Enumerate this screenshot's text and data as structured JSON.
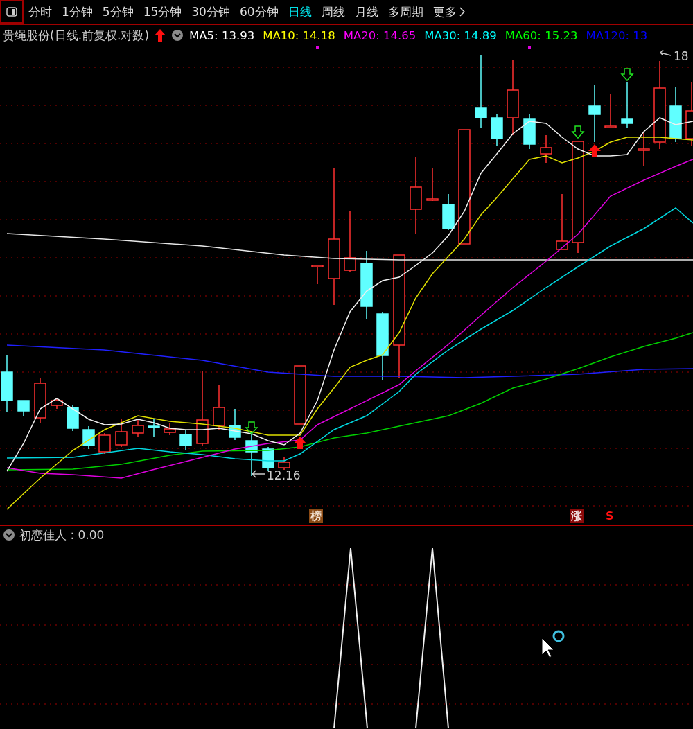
{
  "toolbar": {
    "periods": [
      {
        "label": "分时",
        "selected": false
      },
      {
        "label": "1分钟",
        "selected": false
      },
      {
        "label": "5分钟",
        "selected": false
      },
      {
        "label": "15分钟",
        "selected": false
      },
      {
        "label": "30分钟",
        "selected": false
      },
      {
        "label": "60分钟",
        "selected": false
      },
      {
        "label": "日线",
        "selected": true
      },
      {
        "label": "周线",
        "selected": false
      },
      {
        "label": "月线",
        "selected": false
      },
      {
        "label": "多周期",
        "selected": false
      }
    ],
    "more": "更多"
  },
  "legend": {
    "title": "贵绳股份(日线.前复权.对数)",
    "moving_averages": [
      {
        "label": "MA5: 13.93",
        "color": "#ffffff"
      },
      {
        "label": "MA10: 14.18",
        "color": "#ffff00"
      },
      {
        "label": "MA20: 14.65",
        "color": "#ff00ff"
      },
      {
        "label": "MA30: 14.89",
        "color": "#00ffff"
      },
      {
        "label": "MA60: 15.23",
        "color": "#00ff00"
      },
      {
        "label": "MA120: 13",
        "color": "#0000ff"
      }
    ]
  },
  "chart": {
    "high_marker": "18",
    "low_marker": "12.16",
    "events": [
      {
        "label": "榜",
        "kind": "rank"
      },
      {
        "label": "涨",
        "kind": "limit"
      },
      {
        "label": "S",
        "kind": "signal"
      }
    ]
  },
  "indicator": {
    "title": "初恋佳人 : 0.00"
  }
}
